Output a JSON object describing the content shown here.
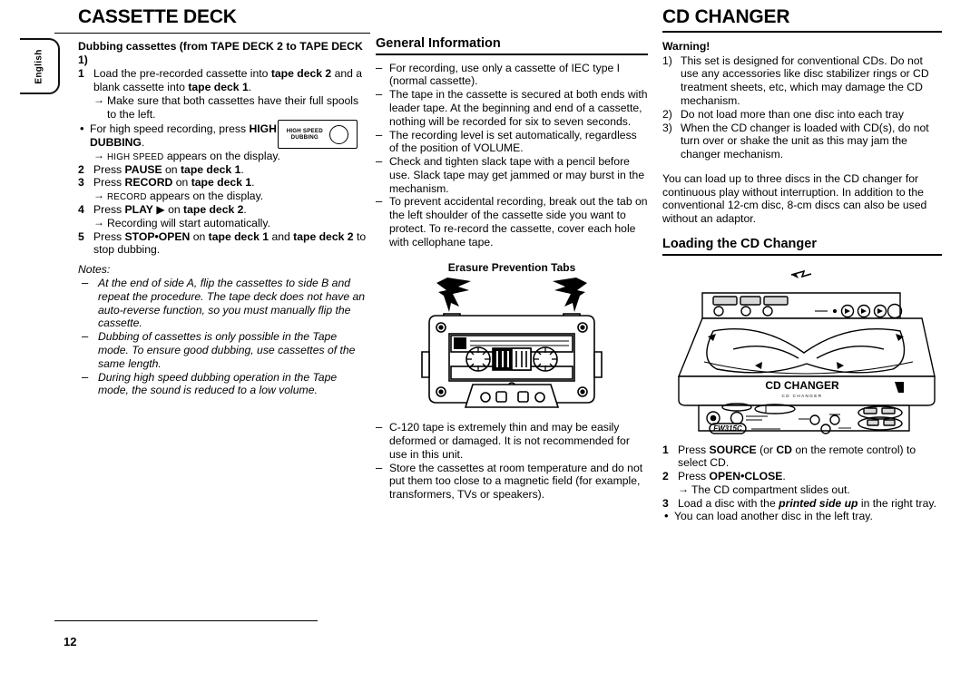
{
  "page": {
    "number": "12",
    "language_tab": "English"
  },
  "left_column": {
    "section_title": "CASSETTE DECK",
    "lead": "Dubbing cassettes (from TAPE DECK 2 to TAPE DECK 1)",
    "steps": [
      {
        "marker": "1",
        "html": "Load the pre-recorded cassette into <b>tape deck 2</b> and a blank cassette into <b>tape deck 1</b>."
      },
      {
        "marker": "2",
        "html": "Press <b>PAUSE</b> on <b>tape deck 1</b>."
      },
      {
        "marker": "3",
        "html": "Press <b>RECORD</b> on <b>tape deck 1</b>."
      },
      {
        "marker": "4",
        "html": "Press <b>PLAY</b> ▶ on <b>tape deck 2</b>."
      },
      {
        "marker": "5",
        "html": "Press <b>STOP•OPEN</b> on <b>tape deck 1</b> and <b>tape deck 2</b> to stop dubbing."
      }
    ],
    "sub_1_arrow": "Make sure that both cassettes have their full spools to the left.",
    "bullet_high_speed": "For high speed recording, press <b>HIGH SPEED DUBBING</b>.",
    "arrow_high_speed": "<span class=\"smallcaps\">HIGH SPEED</span> appears on the display.",
    "arrow_record": "<span class=\"smallcaps\">RECORD</span> appears on the display.",
    "arrow_recording_start": "Recording will start automatically.",
    "hsd_button": {
      "label_line1": "HIGH SPEED",
      "label_line2": "DUBBING"
    },
    "notes_heading": "Notes:",
    "notes": [
      "At the end of side A, flip the cassettes to side B and repeat the procedure. The tape deck does not have an auto-reverse function, so you must manually flip the cassette.",
      "Dubbing of cassettes is only possible in the Tape mode. To ensure good dubbing, use cassettes of the same length.",
      "During high speed dubbing operation in the Tape mode, the sound is reduced to a low volume."
    ]
  },
  "mid_column": {
    "title": "General Information",
    "items_top": [
      "For recording, use only a cassette of IEC type I (normal cassette).",
      "The tape in the cassette is secured at both ends with leader tape. At the beginning and end of a cassette, nothing will be recorded for six to seven seconds.",
      "The recording level is set automatically, regardless of the position of VOLUME.",
      "Check and tighten slack tape with a pencil before use. Slack tape may get jammed or may burst in the mechanism.",
      "To prevent accidental recording, break out the tab on the left shoulder of the cassette side you want to protect. To re-record the cassette, cover each hole with cellophane tape."
    ],
    "figure_caption": "Erasure Prevention Tabs",
    "figure_name": "cassette-tape-illustration",
    "items_bottom": [
      "C-120 tape is extremely thin and may be easily deformed or damaged. It is not recommended for use in this unit.",
      "Store the cassettes at room temperature and do not put them too close to a magnetic field (for example, transformers, TVs or speakers)."
    ]
  },
  "right_column": {
    "section_title": "CD CHANGER",
    "warning_heading": "Warning!",
    "warnings": [
      {
        "marker": "1)",
        "text": "This set is designed for conventional CDs. Do not use any accessories like disc stabilizer rings or CD treatment sheets, etc, which may damage the CD mechanism."
      },
      {
        "marker": "2)",
        "text": "Do not load more than one disc into each tray"
      },
      {
        "marker": "3)",
        "text": "When the CD changer is loaded with CD(s), do not turn over or shake the unit as this may jam the changer mechanism."
      }
    ],
    "paragraph": "You can load up to three discs in the CD changer for continuous play without interruption. In addition to the conventional 12-cm disc, 8-cm discs can also be used without an adaptor.",
    "loading_title": "Loading the CD Changer",
    "figure_name": "cd-changer-illustration",
    "figure_labels": {
      "front_badge": "CD CHANGER",
      "model": "FW315C"
    },
    "steps": [
      {
        "marker": "1",
        "html": "Press <b>SOURCE</b> (or <b>CD</b> on the remote control) to select CD."
      },
      {
        "marker": "2",
        "html": "Press <b>OPEN•CLOSE</b>."
      },
      {
        "marker": "3",
        "html": "Load a disc with the <span class=\"bi\">printed side up</span> in the right tray."
      }
    ],
    "arrow_open_close": "The CD compartment slides out.",
    "bullet_left_tray": "You can load another disc in the left tray."
  }
}
